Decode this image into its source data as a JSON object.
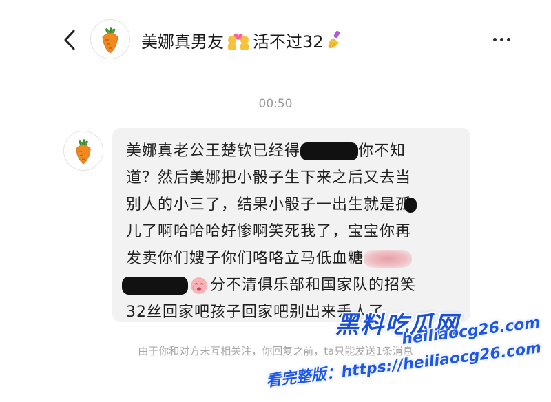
{
  "header": {
    "title_part1": "美娜真男友",
    "title_part2": "活不过32",
    "back_icon": "chevron-left-icon",
    "avatar_icon": "carrot-icon",
    "more_icon": "more-dots-icon"
  },
  "timestamp": "00:50",
  "message": {
    "avatar_icon": "carrot-icon",
    "lines": [
      {
        "a": "美娜真老公王楚钦已经得",
        "b": "你不知"
      },
      {
        "a": "道？然后美娜把小骰子生下来之后又去当"
      },
      {
        "a": "别人的小三了，结果小骰子一出生就是孤"
      },
      {
        "a": "儿了啊哈哈哈好惨啊笑死我了，宝宝你再"
      },
      {
        "a": "发卖你们嫂子你们咯咯立马低血糖"
      },
      {
        "a": "分不清俱乐部和国家队的招笑"
      },
      {
        "a": "32丝回家吧孩子回家吧别出来丢人了"
      }
    ]
  },
  "notice": "由于你和对方未互相关注，你回复之前，ta只能发送1条消息",
  "watermark": {
    "site_name": "黑料吃瓜网",
    "domain": "heiliaocg26.com",
    "full": "看完整版：https://heiliaocg26.com"
  },
  "colors": {
    "bubble": "#f2f2f2",
    "timestamp": "#9a9a9a",
    "notice": "#a8a8a8",
    "watermark_blue": "#1e57e8"
  }
}
